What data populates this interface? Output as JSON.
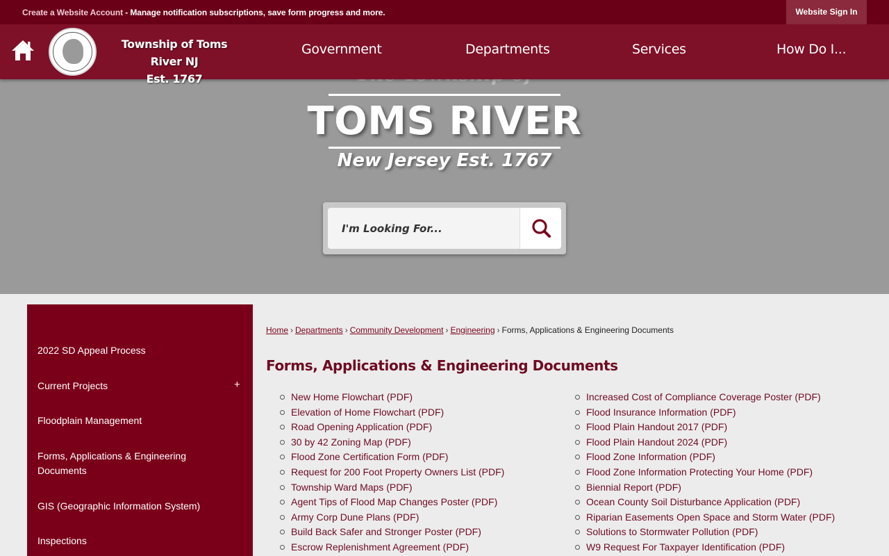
{
  "topbar": {
    "account_link": "Create a Website Account",
    "account_desc": " - Manage notification subscriptions, save form progress and more.",
    "signin": "Website Sign In"
  },
  "header": {
    "brand_line1": "Township of Toms River  NJ",
    "brand_line2": "Est. 1767",
    "nav": [
      "Government",
      "Departments",
      "Services",
      "How Do I..."
    ]
  },
  "hero": {
    "small_title": "The Township of",
    "big_title": "TOMS RIVER",
    "subtitle": "New Jersey Est. 1767",
    "search_placeholder": "I'm Looking For..."
  },
  "sidebar": {
    "items": [
      {
        "label": "2022 SD Appeal Process"
      },
      {
        "label": "Current Projects",
        "expand": "+"
      },
      {
        "label": "Floodplain Management"
      },
      {
        "label": "Forms, Applications & Engineering Documents"
      },
      {
        "label": "GIS (Geographic Information System)"
      },
      {
        "label": "Inspections"
      }
    ]
  },
  "breadcrumb": {
    "items": [
      "Home",
      "Departments",
      "Community Development",
      "Engineering"
    ],
    "current": "Forms, Applications & Engineering Documents",
    "separator": "›"
  },
  "main": {
    "title": "Forms, Applications & Engineering Documents",
    "left_docs": [
      "New Home Flowchart (PDF)",
      "Elevation of Home Flowchart (PDF)",
      "Road Opening Application (PDF)",
      "30 by 42 Zoning Map (PDF)",
      "Flood Zone Certification Form (PDF)",
      "Request for 200 Foot Property Owners List (PDF)",
      "Township Ward Maps (PDF)",
      "Agent Tips of Flood Map Changes Poster (PDF)",
      "Army Corp Dune Plans (PDF)",
      "Build Back Safer and Stronger Poster (PDF)",
      "Escrow Replenishment Agreement (PDF)"
    ],
    "right_docs": [
      "Increased Cost of Compliance Coverage Poster (PDF)",
      "Flood Insurance Information (PDF)",
      "Flood Plain Handout 2017 (PDF)",
      "Flood Plain Handout 2024 (PDF)",
      "Flood Zone Information (PDF)",
      "Flood Zone Information Protecting Your Home (PDF)",
      "Biennial Report (PDF)",
      "Ocean County Soil Disturbance Application (PDF)",
      "Riparian Easements Open Space and Storm Water (PDF)",
      "Solutions to Stormwater Pollution (PDF)",
      "W9 Request For Taxpayer Identification (PDF)"
    ]
  },
  "colors": {
    "topbar": "#6a0018",
    "header": "#7e1028",
    "sidebar": "#7a0019",
    "link": "#6e0b22"
  }
}
